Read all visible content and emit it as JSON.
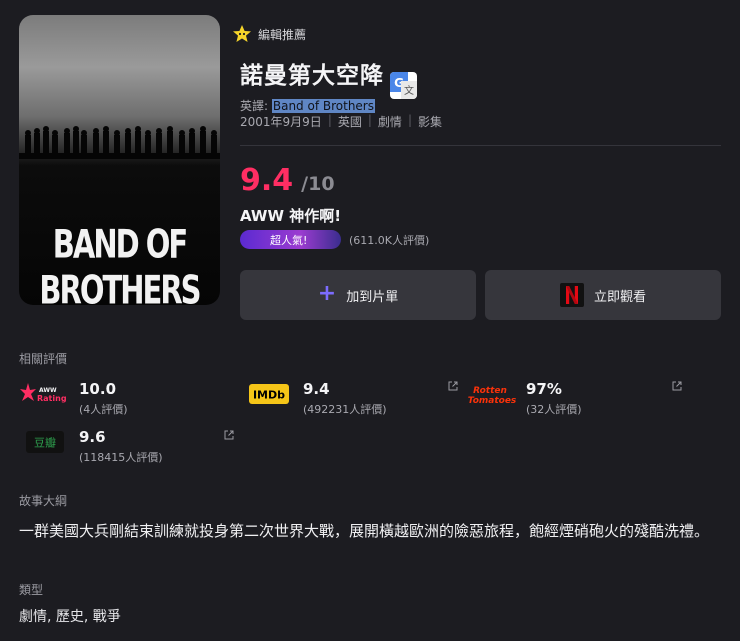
{
  "poster": {
    "title": "BAND OF BROTHERS"
  },
  "badge": {
    "icon": "star-badge-icon",
    "label": "編輯推薦"
  },
  "title": "諾曼第大空降",
  "english": {
    "prefix": "英譯: ",
    "title": "Band of Brothers"
  },
  "meta": [
    "2001年9月9日",
    "英國",
    "劇情",
    "影集"
  ],
  "score": {
    "value": "9.4",
    "denominator": "/10",
    "label": "AWW 神作啊!"
  },
  "popularity": {
    "badge": "超人氣!",
    "count": "(611.0K人評價)"
  },
  "actions": {
    "add": "加到片單",
    "watch": "立即觀看",
    "accent": "#7c6cff"
  },
  "ratings_section": "相關評價",
  "ratings": [
    {
      "source": "AWW Rating",
      "logo_lines": [
        "AWW",
        "Rating"
      ],
      "value": "10.0",
      "count": "(4人評價)"
    },
    {
      "source": "IMDb",
      "value": "9.4",
      "count": "(492231人評價)"
    },
    {
      "source": "Rotten Tomatoes",
      "logo_lines": [
        "Rotten",
        "Tomatoes"
      ],
      "value": "97%",
      "count": "(32人評價)"
    },
    {
      "source": "豆瓣",
      "value": "9.6",
      "count": "(118415人評價)"
    }
  ],
  "synopsis": {
    "label": "故事大綱",
    "text": "一群美國大兵剛結束訓練就投身第二次世界大戰，展開橫越歐洲的險惡旅程，飽經煙硝砲火的殘酷洗禮。"
  },
  "genre": {
    "label": "類型",
    "text": "劇情, 歷史, 戰爭"
  },
  "colors": {
    "score": "#ff2e63",
    "background": "#1c1c21",
    "button": "#36363c"
  }
}
